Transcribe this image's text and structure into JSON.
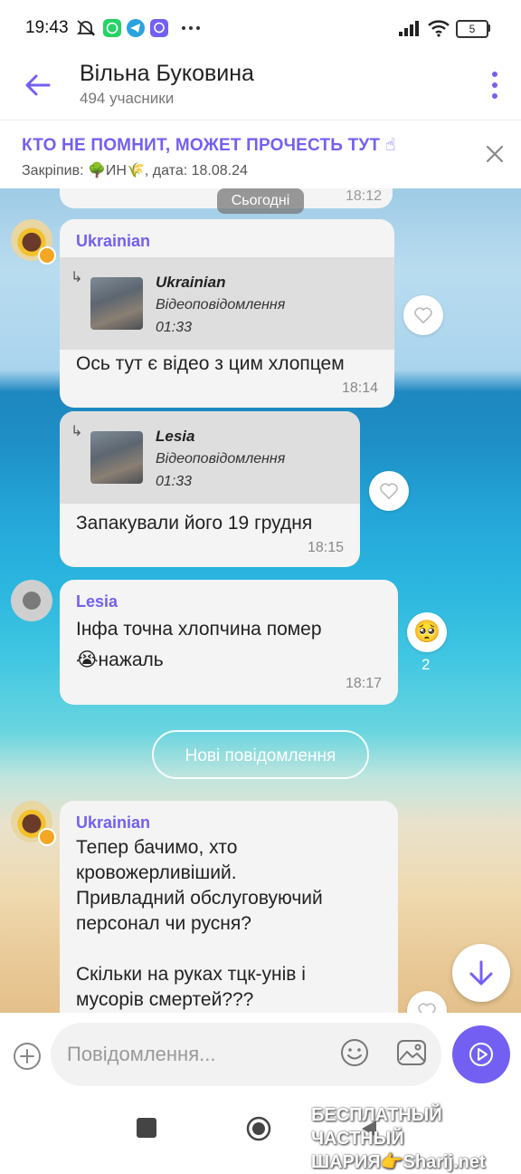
{
  "status_bar": {
    "time": "19:43",
    "battery": "5"
  },
  "header": {
    "title": "Вільна Буковина",
    "members": "494 учасники"
  },
  "pinned": {
    "text": "КТО НЕ ПОМНИТ, МОЖЕТ ПРОЧЕСТЬ ТУТ ☝",
    "meta": "Закріпив: 🌳ИН🌾, дата: 18.08.24"
  },
  "chat": {
    "prev_time": "18:12",
    "date_divider": "Сьогодні",
    "messages": [
      {
        "sender": "Ukrainian",
        "quote_name": "Ukrainian",
        "quote_type": "Відеоповідомлення",
        "quote_duration": "01:33",
        "text": "Ось тут є відео з цим хлопцем",
        "time": "18:14"
      },
      {
        "quote_name": "Lesia",
        "quote_type": "Відеоповідомлення",
        "quote_duration": "01:33",
        "text": "Запакували його 19 грудня",
        "time": "18:15"
      },
      {
        "sender": "Lesia",
        "text": "Інфа точна хлопчина помер\n😭нажаль",
        "time": "18:17",
        "reaction_emoji": "🥺",
        "reaction_count": "2"
      },
      {
        "sender": "Ukrainian",
        "text": "Тепер бачимо, хто\nкровожерливіший.\nПривладний обслуговуючий\nперсонал чи русня?\n\nСкільки на руках тцк-унів і\nмусорів смертей???"
      }
    ],
    "new_messages": "Нові повідомлення"
  },
  "input": {
    "placeholder": "Повідомлення..."
  },
  "watermark": {
    "line1": "БЕСПЛАТНЫЙ ЧАСТНЫЙ",
    "line2": "ШАРИЯ👉Sharij.net"
  },
  "colors": {
    "accent": "#7360f2",
    "bubble": "#f4f4f4",
    "quote": "#dedede"
  },
  "icons": [
    "back-arrow-icon",
    "more-vert-icon",
    "close-icon",
    "heart-icon",
    "plus-icon",
    "emoji-icon",
    "image-icon",
    "send-icon",
    "arrow-down-icon"
  ]
}
